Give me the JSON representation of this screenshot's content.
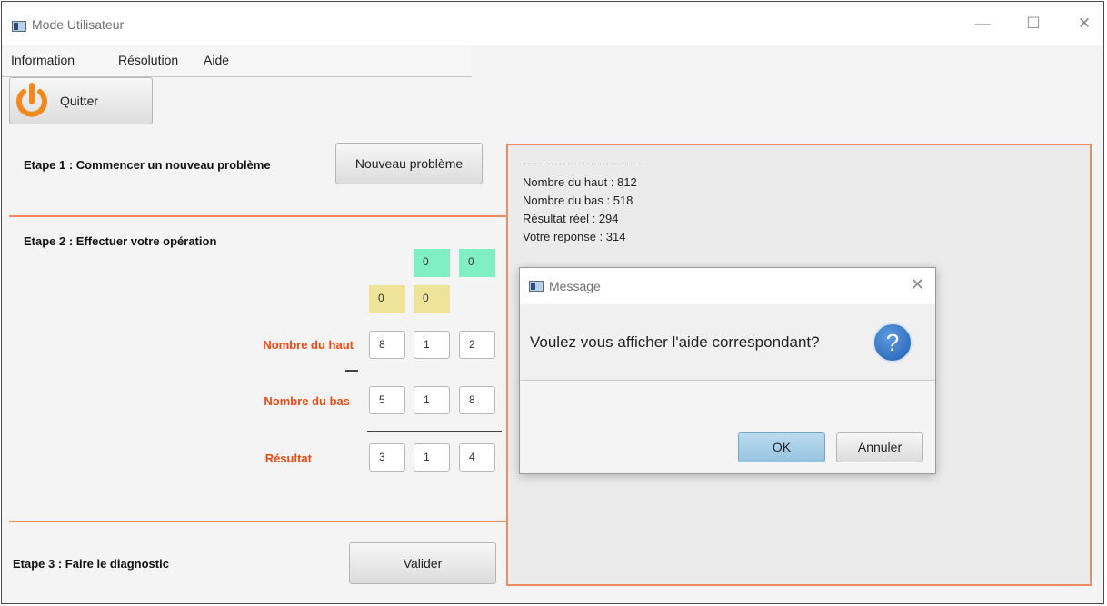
{
  "window": {
    "title": "Mode Utilisateur"
  },
  "menu": {
    "items": [
      "Information",
      "Résolution",
      "Aide"
    ]
  },
  "toolbar": {
    "quit_label": "Quitter"
  },
  "step1": {
    "label": "Etape 1 : Commencer un nouveau problème",
    "button": "Nouveau problème"
  },
  "step2": {
    "label": "Etape 2 : Effectuer votre opération",
    "carry_top": [
      "0",
      "0"
    ],
    "carry_bottom": [
      "0",
      "0"
    ],
    "top_label": "Nombre du haut",
    "top_digits": [
      "8",
      "1",
      "2"
    ],
    "bottom_label": "Nombre du bas",
    "bottom_digits": [
      "5",
      "1",
      "8"
    ],
    "result_label": "Résultat",
    "result_digits": [
      "3",
      "1",
      "4"
    ]
  },
  "step3": {
    "label": "Etape 3 : Faire le diagnostic",
    "button": "Valider"
  },
  "output": {
    "separator": "------------------------------",
    "lines": [
      "Nombre du haut : 812",
      "Nombre du bas : 518",
      "Résultat réel : 294",
      "Votre reponse : 314"
    ]
  },
  "dialog": {
    "title": "Message",
    "message": "Voulez vous afficher l'aide correspondant?",
    "ok": "OK",
    "cancel": "Annuler"
  },
  "colors": {
    "accent": "#f08c5e",
    "label_red": "#f0480e",
    "carry_green": "#80f0c4",
    "carry_yellow": "#ede49a",
    "ok_blue": "#a9cde6"
  }
}
